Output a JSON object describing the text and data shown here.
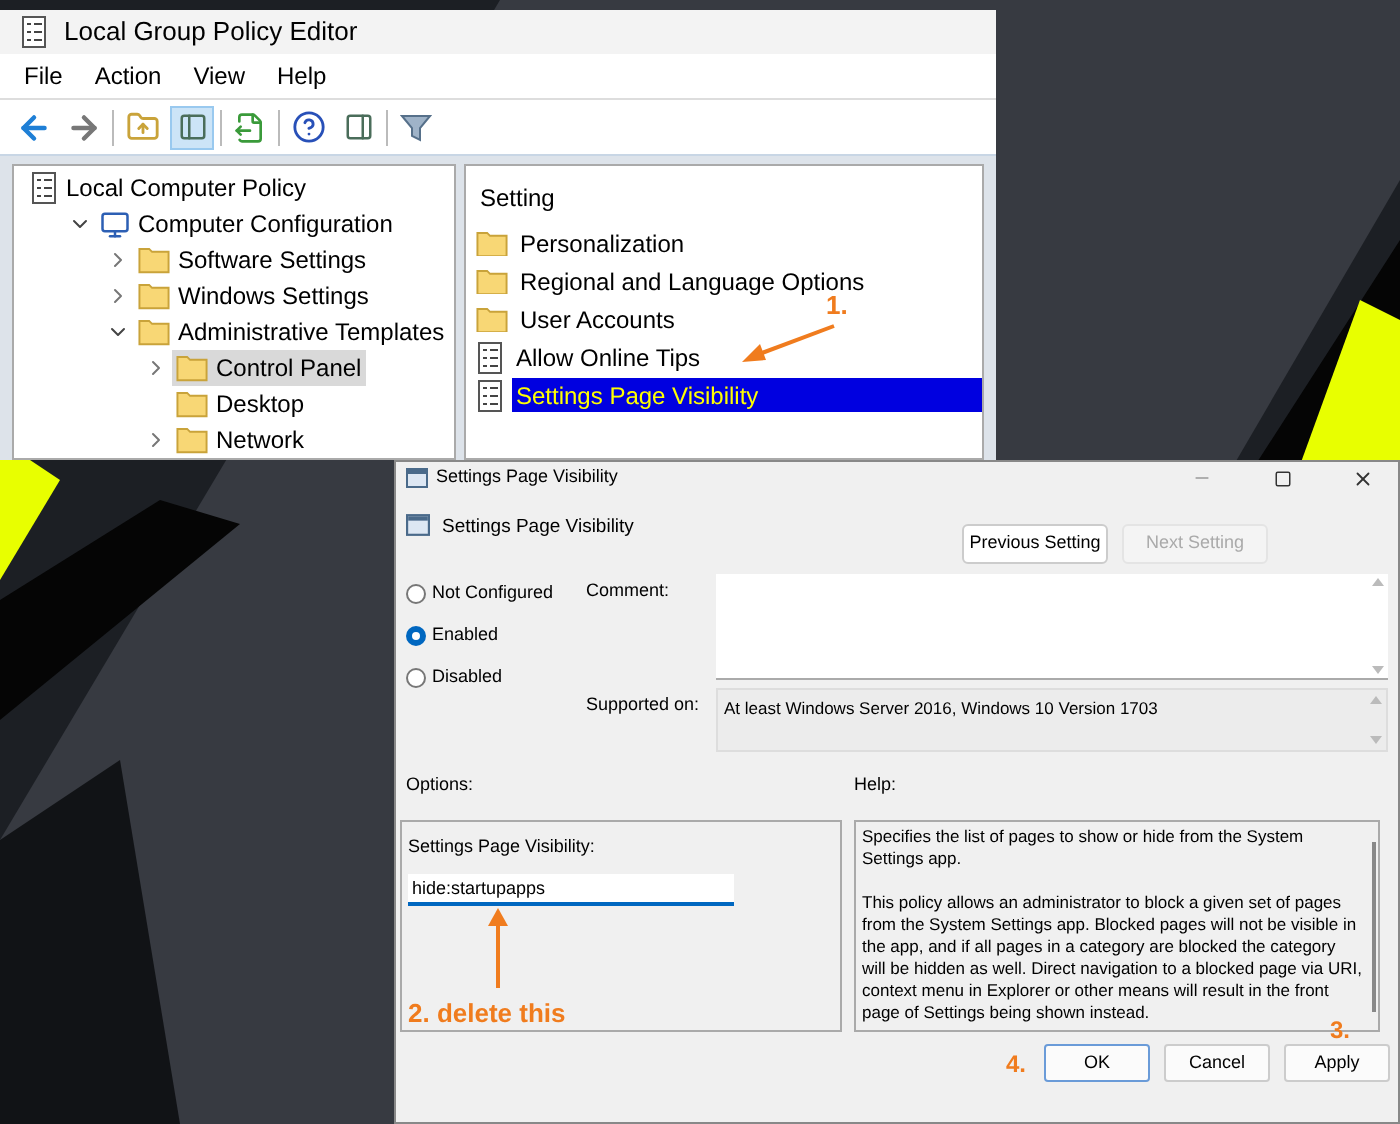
{
  "policy_editor": {
    "title": "Local Group Policy Editor",
    "menu": [
      "File",
      "Action",
      "View",
      "Help"
    ],
    "tree": [
      {
        "label": "Local Computer Policy",
        "kind": "policy",
        "selected": false,
        "children": [
          {
            "label": "Computer Configuration",
            "kind": "computer",
            "expanded": true,
            "selected": false,
            "children": [
              {
                "label": "Software Settings",
                "kind": "folder",
                "expanded": false,
                "selected": false
              },
              {
                "label": "Windows Settings",
                "kind": "folder",
                "expanded": false,
                "selected": false
              },
              {
                "label": "Administrative Templates",
                "kind": "folder",
                "expanded": true,
                "selected": false,
                "children": [
                  {
                    "label": "Control Panel",
                    "kind": "folder",
                    "expanded": false,
                    "selected": true
                  },
                  {
                    "label": "Desktop",
                    "kind": "folder",
                    "selected": false
                  },
                  {
                    "label": "Network",
                    "kind": "folder",
                    "expanded": false,
                    "selected": false
                  }
                ]
              }
            ]
          }
        ]
      }
    ],
    "list_header": "Setting",
    "list": [
      {
        "kind": "folder",
        "label": "Personalization",
        "selected": false
      },
      {
        "kind": "folder",
        "label": "Regional and Language Options",
        "selected": false
      },
      {
        "kind": "folder",
        "label": "User Accounts",
        "selected": false
      },
      {
        "kind": "setting",
        "label": "Allow Online Tips",
        "selected": false
      },
      {
        "kind": "setting",
        "label": "Settings Page Visibility",
        "selected": true
      }
    ],
    "annotation": "1."
  },
  "dialog": {
    "title": "Settings Page Visibility",
    "header": "Settings Page Visibility",
    "nav_buttons": [
      {
        "label": "Previous Setting",
        "disabled": false
      },
      {
        "label": "Next Setting",
        "disabled": true
      }
    ],
    "radios": [
      {
        "label": "Not Configured",
        "selected": false
      },
      {
        "label": "Enabled",
        "selected": true
      },
      {
        "label": "Disabled",
        "selected": false
      }
    ],
    "comment_label": "Comment:",
    "supported_label": "Supported on:",
    "supported_value": "At least Windows Server 2016, Windows 10 Version 1703",
    "options_label": "Options:",
    "help_label": "Help:",
    "option_field": {
      "label": "Settings Page Visibility:",
      "value": "hide:startupapps"
    },
    "help_text": [
      "Specifies the list of pages to show or hide from the System Settings app.",
      "This policy allows an administrator to block a given set of pages from the System Settings app. Blocked pages will not be visible in the app, and if all pages in a category are blocked the category will be hidden as well. Direct navigation to a blocked page via URI, context menu in Explorer or other means will result in the front page of Settings being shown instead."
    ],
    "buttons": [
      {
        "label": "OK",
        "default": true
      },
      {
        "label": "Cancel",
        "default": false
      },
      {
        "label": "Apply",
        "default": false
      }
    ],
    "annotations": {
      "field": "2. delete this",
      "apply": "3.",
      "ok": "4."
    }
  }
}
